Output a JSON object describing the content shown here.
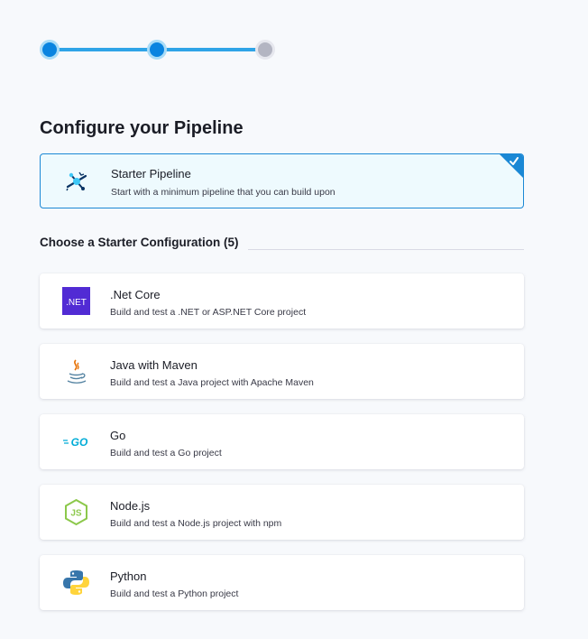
{
  "stepper": {
    "steps": [
      {
        "state": "complete"
      },
      {
        "state": "current"
      },
      {
        "state": "pending"
      }
    ]
  },
  "page_title": "Configure your Pipeline",
  "starter": {
    "title": "Starter Pipeline",
    "description": "Start with a minimum pipeline that you can build upon",
    "selected": true,
    "icon": "starter-pipeline-icon"
  },
  "section": {
    "label": "Choose a Starter Configuration (5)"
  },
  "configs": [
    {
      "title": ".Net Core",
      "description": "Build and test a .NET or ASP.NET Core project",
      "icon": "dotnet-icon",
      "icon_text": ".NET"
    },
    {
      "title": "Java with Maven",
      "description": "Build and test a Java project with Apache Maven",
      "icon": "java-icon"
    },
    {
      "title": "Go",
      "description": "Build and test a Go project",
      "icon": "go-icon",
      "icon_text": "GO"
    },
    {
      "title": "Node.js",
      "description": "Build and test a Node.js project with npm",
      "icon": "nodejs-icon",
      "icon_text": "JS"
    },
    {
      "title": "Python",
      "description": "Build and test a Python project",
      "icon": "python-icon"
    }
  ],
  "colors": {
    "accent": "#0a84e0",
    "selected_border": "#1b88d5",
    "selected_bg": "#eefafe"
  }
}
